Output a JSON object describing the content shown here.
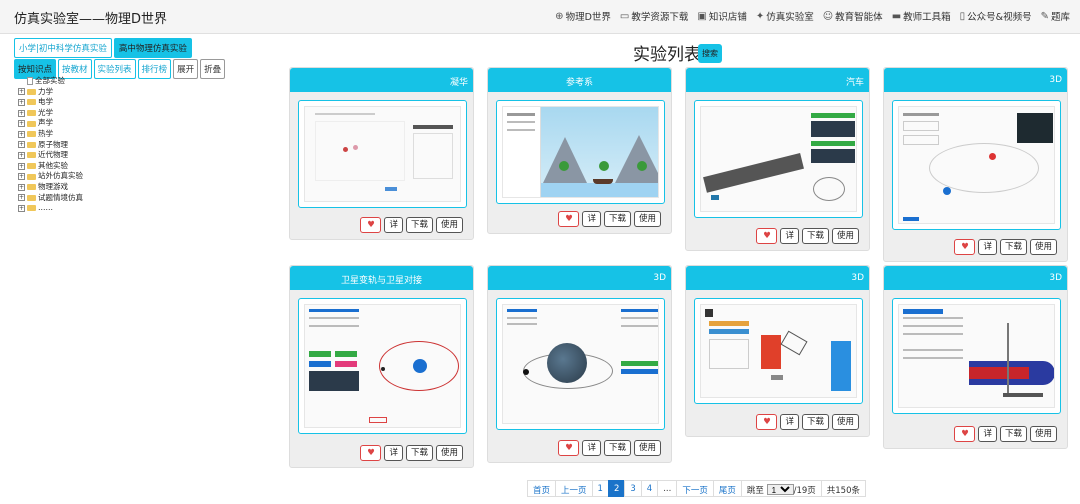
{
  "header": {
    "brand": "仿真实验室——物理D世界",
    "nav": [
      {
        "icon": "⊕",
        "icon_name": "globe-icon",
        "label": "物理D世界"
      },
      {
        "icon": "▭",
        "icon_name": "book-icon",
        "label": "教学资源下载"
      },
      {
        "icon": "▣",
        "icon_name": "shop-icon",
        "label": "知识店铺"
      },
      {
        "icon": "✦",
        "icon_name": "tools-icon",
        "label": "仿真实验室"
      },
      {
        "icon": "☺",
        "icon_name": "robot-icon",
        "label": "教育智能体"
      },
      {
        "icon": "▬",
        "icon_name": "toolbox-icon",
        "label": "教师工具箱"
      },
      {
        "icon": "▯",
        "icon_name": "phone-icon",
        "label": "公众号&视频号"
      },
      {
        "icon": "✎",
        "icon_name": "edit-icon",
        "label": "题库"
      }
    ]
  },
  "left": {
    "category_tabs": [
      "小学|初中科学仿真实验",
      "高中物理仿真实验"
    ],
    "view_tabs": [
      "按知识点",
      "按教材",
      "实验列表",
      "排行榜",
      "展开",
      "折叠"
    ],
    "tree": [
      "全部实验",
      "力学",
      "电学",
      "光学",
      "声学",
      "热学",
      "原子物理",
      "近代物理",
      "其他实验",
      "站外仿真实验",
      "物理游戏",
      "试题情境仿真",
      "……"
    ]
  },
  "main": {
    "title": "实验列表",
    "search_label": "搜索",
    "cards": [
      {
        "title": "",
        "tag": "凝华"
      },
      {
        "title": "参考系",
        "tag": ""
      },
      {
        "title": "",
        "tag": "汽车"
      },
      {
        "title": "",
        "tag": "3D"
      },
      {
        "title": "卫星变轨与卫星对接",
        "tag": ""
      },
      {
        "title": "",
        "tag": "3D"
      },
      {
        "title": "",
        "tag": "3D"
      },
      {
        "title": "",
        "tag": "3D"
      }
    ],
    "actions": {
      "detail": "详",
      "download": "下载",
      "use": "使用"
    },
    "thumb_button": "调节"
  },
  "pagination": {
    "first": "首页",
    "prev": "上一页",
    "pages": [
      "1",
      "2",
      "3",
      "4"
    ],
    "current": "2",
    "ellipsis": "...",
    "next": "下一页",
    "last": "尾页",
    "jump_label": "跳至",
    "jump_value": "1",
    "total_pages": "/19页",
    "total_items": "共150条"
  },
  "colors": {
    "accent": "#16c2e6",
    "heart": "#dd4444",
    "page_active": "#1a73c9"
  }
}
